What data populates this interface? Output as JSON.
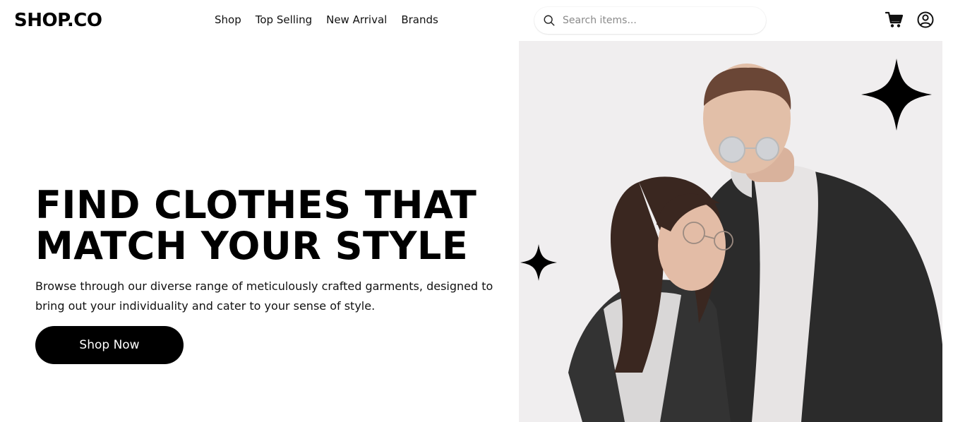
{
  "header": {
    "logo": "SHOP.CO",
    "nav": [
      "Shop",
      "Top Selling",
      "New Arrival",
      "Brands"
    ],
    "search": {
      "placeholder": "Search items...",
      "value": "",
      "icon": "search-icon"
    },
    "icons": [
      "cart-icon",
      "user-circle-icon"
    ]
  },
  "hero": {
    "title_line1": "FIND CLOTHES THAT",
    "title_line2": "MATCH YOUR STYLE",
    "description": "Browse through our diverse range of meticulously crafted garments, designed to bring out your individuality and cater to your sense of style.",
    "cta_label": "Shop Now",
    "image": "couple-in-denim-jackets-photo",
    "decorations": [
      "sparkle-star-large",
      "sparkle-star-small"
    ]
  },
  "colors": {
    "primary": "#000000",
    "background": "#ffffff",
    "hero_image_bg": "#f0eeef"
  }
}
